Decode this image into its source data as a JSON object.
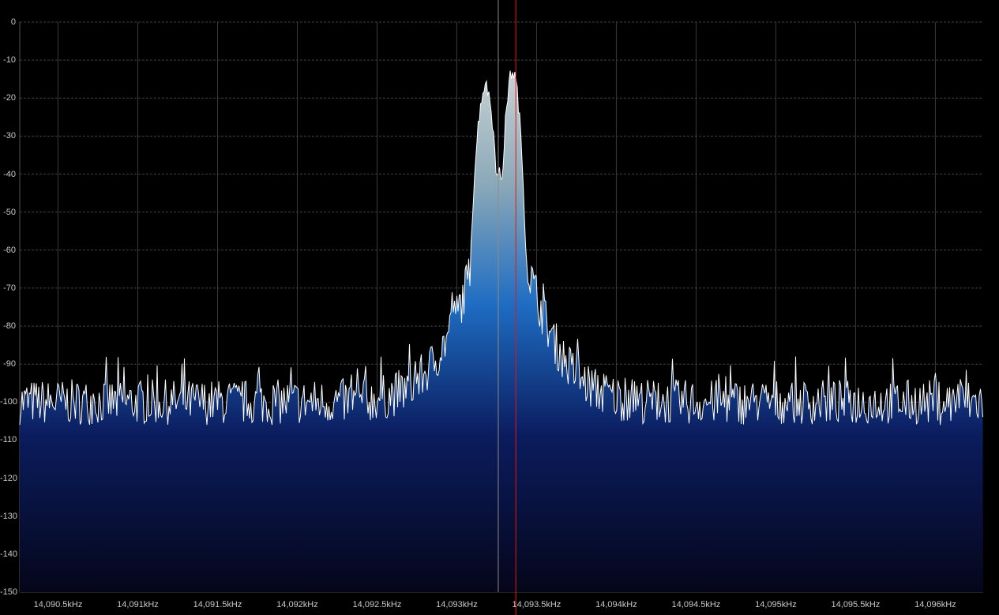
{
  "spectrum": {
    "y_axis_labels": [
      "0",
      "-10",
      "-20",
      "-30",
      "-40",
      "-50",
      "-60",
      "-70",
      "-80",
      "-90",
      "-100",
      "-110",
      "-120",
      "-130",
      "-140",
      "-150"
    ],
    "x_axis_labels": [
      "14,090.5kHz",
      "14,091kHz",
      "14,091.5kHz",
      "14,092kHz",
      "14,092.5kHz",
      "14,093kHz",
      "14,093.5kHz",
      "14,094kHz",
      "14,094.5kHz",
      "14,095kHz",
      "14,095.5kHz",
      "14,096kHz"
    ],
    "y_range_db": [
      -150,
      0
    ],
    "x_range_khz": [
      14090.26,
      14096.3
    ],
    "center_frequency_khz": 14093.26,
    "vfo_frequency_khz": 14093.37,
    "noise_floor_db": -108,
    "peak_frequencies_khz": [
      14093.18,
      14093.35
    ],
    "peak_levels_db": [
      -17,
      -13
    ],
    "colors": {
      "background": "#000000",
      "grid": "#3a3a3a",
      "trace": "#ffffff",
      "fill_top": "#a9bfc6",
      "fill_mid": "#1e6cc2",
      "fill_low": "#0b1c5e",
      "fill_bottom": "#05061a",
      "center_line": "#8c8c8c",
      "vfo_line": "#e01818"
    }
  }
}
